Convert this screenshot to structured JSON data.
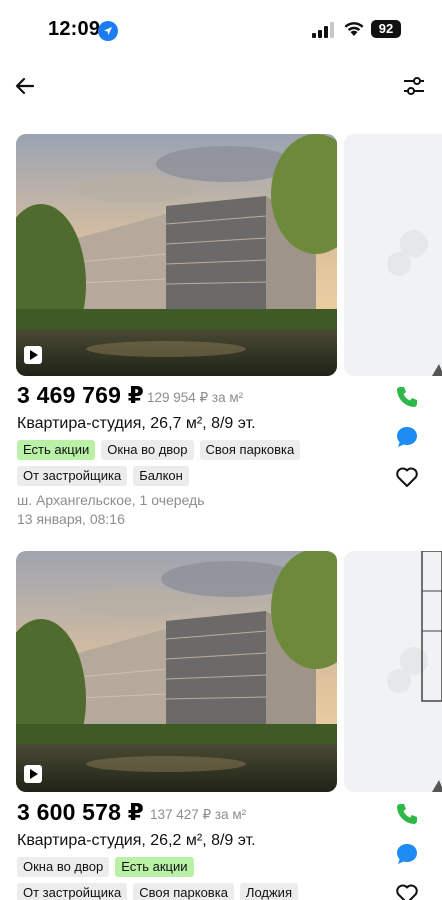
{
  "status_bar": {
    "time": "12:09",
    "battery": "92"
  },
  "colors": {
    "promo_tag": "#b9f1a6",
    "tag": "#ececec",
    "call": "#2fb84a",
    "chat": "#1e8cf2",
    "secondary_text": "#8d8d8d"
  },
  "icons": {
    "back": "arrow-left-icon",
    "filter": "sliders-icon",
    "call": "phone-icon",
    "chat": "chat-bubble-icon",
    "favorite": "heart-icon",
    "video": "play-icon"
  },
  "listings": [
    {
      "price": "3 469 769 ₽",
      "price_per_m2": "129 954 ₽ за м²",
      "title": "Квартира-студия, 26,7 м², 8/9 эт.",
      "tags": [
        {
          "label": "Есть акции",
          "promo": true
        },
        {
          "label": "Окна во двор",
          "promo": false
        },
        {
          "label": "Своя парковка",
          "promo": false
        },
        {
          "label": "От застройщика",
          "promo": false
        },
        {
          "label": "Балкон",
          "promo": false
        }
      ],
      "address": "ш. Архангельское, 1 очередь",
      "date": "13 января, 08:16"
    },
    {
      "price": "3 600 578 ₽",
      "price_per_m2": "137 427 ₽ за м²",
      "title": "Квартира-студия, 26,2 м², 8/9 эт.",
      "tags": [
        {
          "label": "Окна во двор",
          "promo": false
        },
        {
          "label": "Есть акции",
          "promo": true
        },
        {
          "label": "От застройщика",
          "promo": false
        },
        {
          "label": "Своя парковка",
          "promo": false
        },
        {
          "label": "Лоджия",
          "promo": false
        }
      ]
    }
  ]
}
